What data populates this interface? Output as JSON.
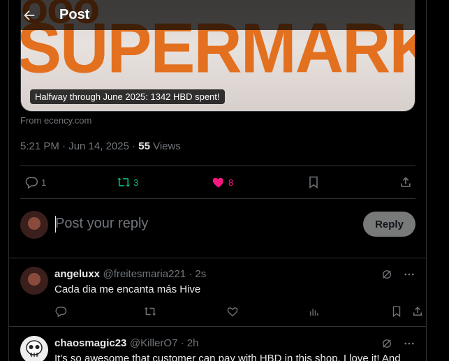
{
  "header": {
    "title": "Post"
  },
  "media": {
    "image_text": "SUPERMARKET",
    "caption": "Halfway through June 2025: 1342 HBD spent!",
    "source": "From ecency.com"
  },
  "post_meta": {
    "timestamp": "5:21 PM · Jun 14, 2025 · ",
    "views_count": "55",
    "views_label": " Views"
  },
  "post_actions": {
    "replies": "1",
    "reposts": "3",
    "likes": "8"
  },
  "reply_composer": {
    "placeholder": "Post your reply",
    "button": "Reply"
  },
  "replies": [
    {
      "name": "angeluxx",
      "handle": "@freitesmaria221 · 2s",
      "text": "Cada dia me encanta más Hive"
    },
    {
      "name": "chaosmagic23",
      "handle": "@KillerO7 · 2h",
      "text": "It's so awesome that customer can pay with HBD in this shop. I love it! And"
    }
  ],
  "colors": {
    "background": "#000000",
    "repost_green": "#00ba7c",
    "like_pink": "#f91880",
    "muted": "#71767b"
  }
}
